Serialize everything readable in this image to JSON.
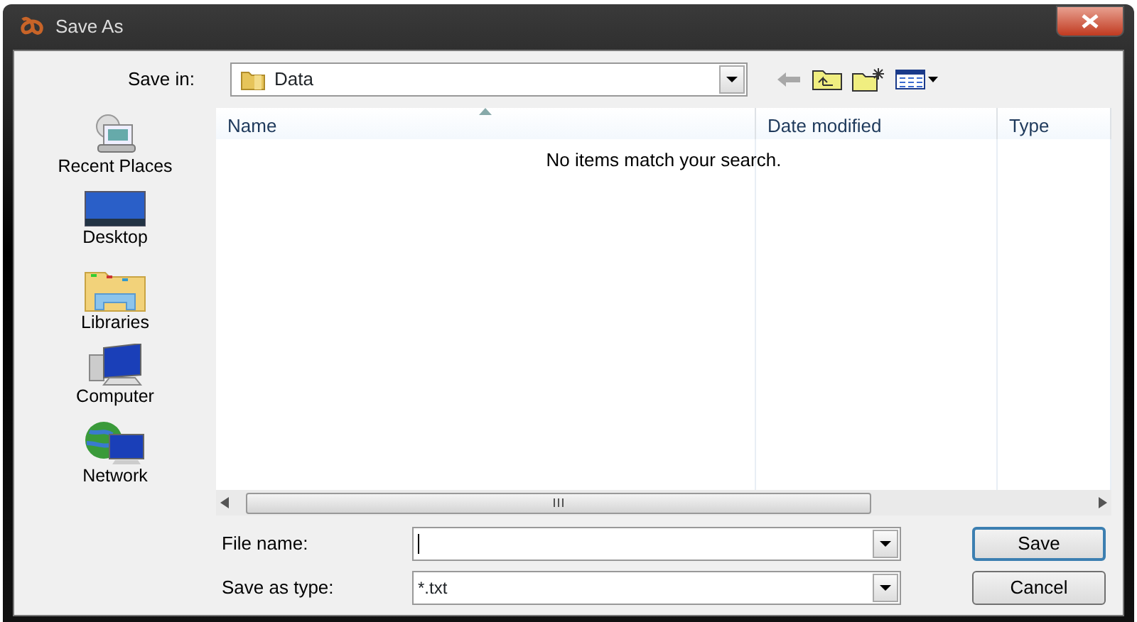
{
  "window": {
    "title": "Save As"
  },
  "save_in": {
    "label": "Save in:",
    "value": "Data"
  },
  "places": [
    {
      "label": "Recent Places",
      "kind": "recent"
    },
    {
      "label": "Desktop",
      "kind": "desktop"
    },
    {
      "label": "Libraries",
      "kind": "libraries"
    },
    {
      "label": "Computer",
      "kind": "computer"
    },
    {
      "label": "Network",
      "kind": "network"
    }
  ],
  "list": {
    "columns": [
      "Name",
      "Date modified",
      "Type"
    ],
    "empty_message": "No items match your search."
  },
  "file_name": {
    "label": "File name:"
  },
  "save_as_type": {
    "label": "Save as type:",
    "value": "*.txt"
  },
  "buttons": [
    {
      "label": "Save",
      "kind": "default"
    },
    {
      "label": "Cancel",
      "kind": "normal"
    }
  ]
}
